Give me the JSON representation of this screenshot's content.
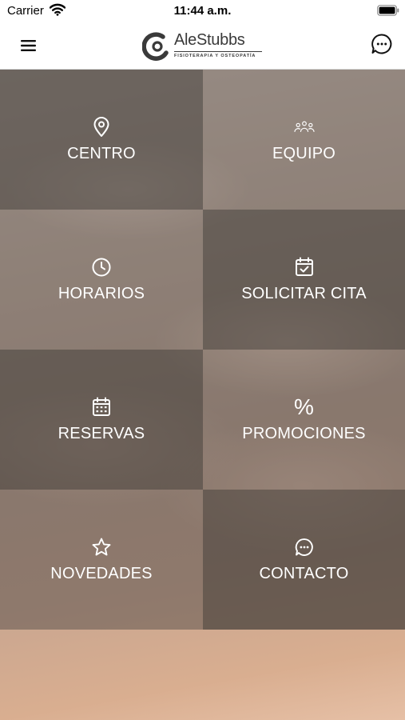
{
  "status_bar": {
    "carrier": "Carrier",
    "time": "11:44 a.m."
  },
  "header": {
    "logo_name": "AleStubbs",
    "logo_subtitle": "FISIOTERAPIA Y OSTEOPATÍA",
    "menu_icon": "hamburger-menu-icon",
    "chat_icon": "chat-bubble-icon"
  },
  "menu": {
    "items": [
      {
        "label": "CENTRO",
        "icon": "map-pin-icon"
      },
      {
        "label": "EQUIPO",
        "icon": "group-icon"
      },
      {
        "label": "HORARIOS",
        "icon": "clock-icon"
      },
      {
        "label": "SOLICITAR CITA",
        "icon": "calendar-check-icon"
      },
      {
        "label": "RESERVAS",
        "icon": "calendar-grid-icon"
      },
      {
        "label": "PROMOCIONES",
        "icon": "percent-icon",
        "glyph": "%"
      },
      {
        "label": "NOVEDADES",
        "icon": "star-icon"
      },
      {
        "label": "CONTACTO",
        "icon": "chat-bubble-icon"
      }
    ]
  },
  "colors": {
    "tile_text": "#ffffff",
    "header_bg": "#ffffff",
    "logo_text": "#3a3a3a"
  }
}
